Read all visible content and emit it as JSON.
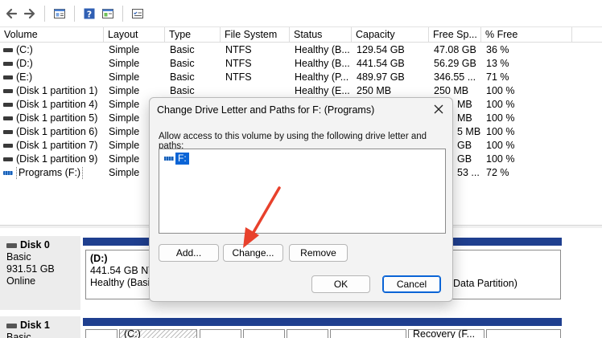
{
  "columns": [
    "Volume",
    "Layout",
    "Type",
    "File System",
    "Status",
    "Capacity",
    "Free Sp...",
    "% Free"
  ],
  "volumes": [
    {
      "name": "(C:)",
      "layout": "Simple",
      "type": "Basic",
      "fs": "NTFS",
      "status": "Healthy (B...",
      "capacity": "129.54 GB",
      "free": "47.08 GB",
      "pct": "36 %",
      "icon": "drive-icon"
    },
    {
      "name": "(D:)",
      "layout": "Simple",
      "type": "Basic",
      "fs": "NTFS",
      "status": "Healthy (B...",
      "capacity": "441.54 GB",
      "free": "56.29 GB",
      "pct": "13 %",
      "icon": "drive-icon"
    },
    {
      "name": "(E:)",
      "layout": "Simple",
      "type": "Basic",
      "fs": "NTFS",
      "status": "Healthy (P...",
      "capacity": "489.97 GB",
      "free": "346.55 ...",
      "pct": "71 %",
      "icon": "drive-icon"
    },
    {
      "name": "(Disk 1 partition 1)",
      "layout": "Simple",
      "type": "Basic",
      "fs": "",
      "status": "Healthy (E...",
      "capacity": "250 MB",
      "free": "250 MB",
      "pct": "100 %",
      "icon": "drive-icon"
    },
    {
      "name": "(Disk 1 partition 4)",
      "layout": "Simple",
      "type": "",
      "fs": "",
      "status": "",
      "capacity": "",
      "free": "MB",
      "pct": "100 %",
      "icon": "drive-icon"
    },
    {
      "name": "(Disk 1 partition 5)",
      "layout": "Simple",
      "type": "",
      "fs": "",
      "status": "",
      "capacity": "",
      "free": "MB",
      "pct": "100 %",
      "icon": "drive-icon"
    },
    {
      "name": "(Disk 1 partition 6)",
      "layout": "Simple",
      "type": "",
      "fs": "",
      "status": "",
      "capacity": "",
      "free": "5 MB",
      "pct": "100 %",
      "icon": "drive-icon"
    },
    {
      "name": "(Disk 1 partition 7)",
      "layout": "Simple",
      "type": "",
      "fs": "",
      "status": "",
      "capacity": "",
      "free": "GB",
      "pct": "100 %",
      "icon": "drive-icon"
    },
    {
      "name": "(Disk 1 partition 9)",
      "layout": "Simple",
      "type": "",
      "fs": "",
      "status": "",
      "capacity": "",
      "free": "GB",
      "pct": "100 %",
      "icon": "drive-icon"
    },
    {
      "name": "Programs (F:)",
      "layout": "Simple",
      "type": "",
      "fs": "",
      "status": "",
      "capacity": "",
      "free": "53 ...",
      "pct": "72 %",
      "icon": "drive-blue-icon"
    }
  ],
  "disks": [
    {
      "name": "Disk 0",
      "type": "Basic",
      "size": "931.51 GB",
      "status": "Online",
      "part_label": "(D:)",
      "part_size": "441.54 GB NT",
      "part_status": "Healthy (Basic",
      "right_text": "Data Partition)"
    },
    {
      "name": "Disk 1",
      "type": "Basic",
      "part_label": "(C:)",
      "right_text": "Recovery (F..."
    }
  ],
  "dialog": {
    "title": "Change Drive Letter and Paths for F: (Programs)",
    "message": "Allow access to this volume by using the following drive letter and paths:",
    "paths": [
      "F:"
    ],
    "add_label": "Add...",
    "change_label": "Change...",
    "remove_label": "Remove",
    "ok_label": "OK",
    "cancel_label": "Cancel"
  },
  "colors": {
    "accent": "#0a64d6",
    "arrow": "#e8412c",
    "disk_bar": "#1f3f8f"
  },
  "toolbar_icons": [
    "back-arrow-icon",
    "forward-arrow-icon",
    "properties-icon",
    "help-icon",
    "view-icon",
    "checklist-icon"
  ]
}
